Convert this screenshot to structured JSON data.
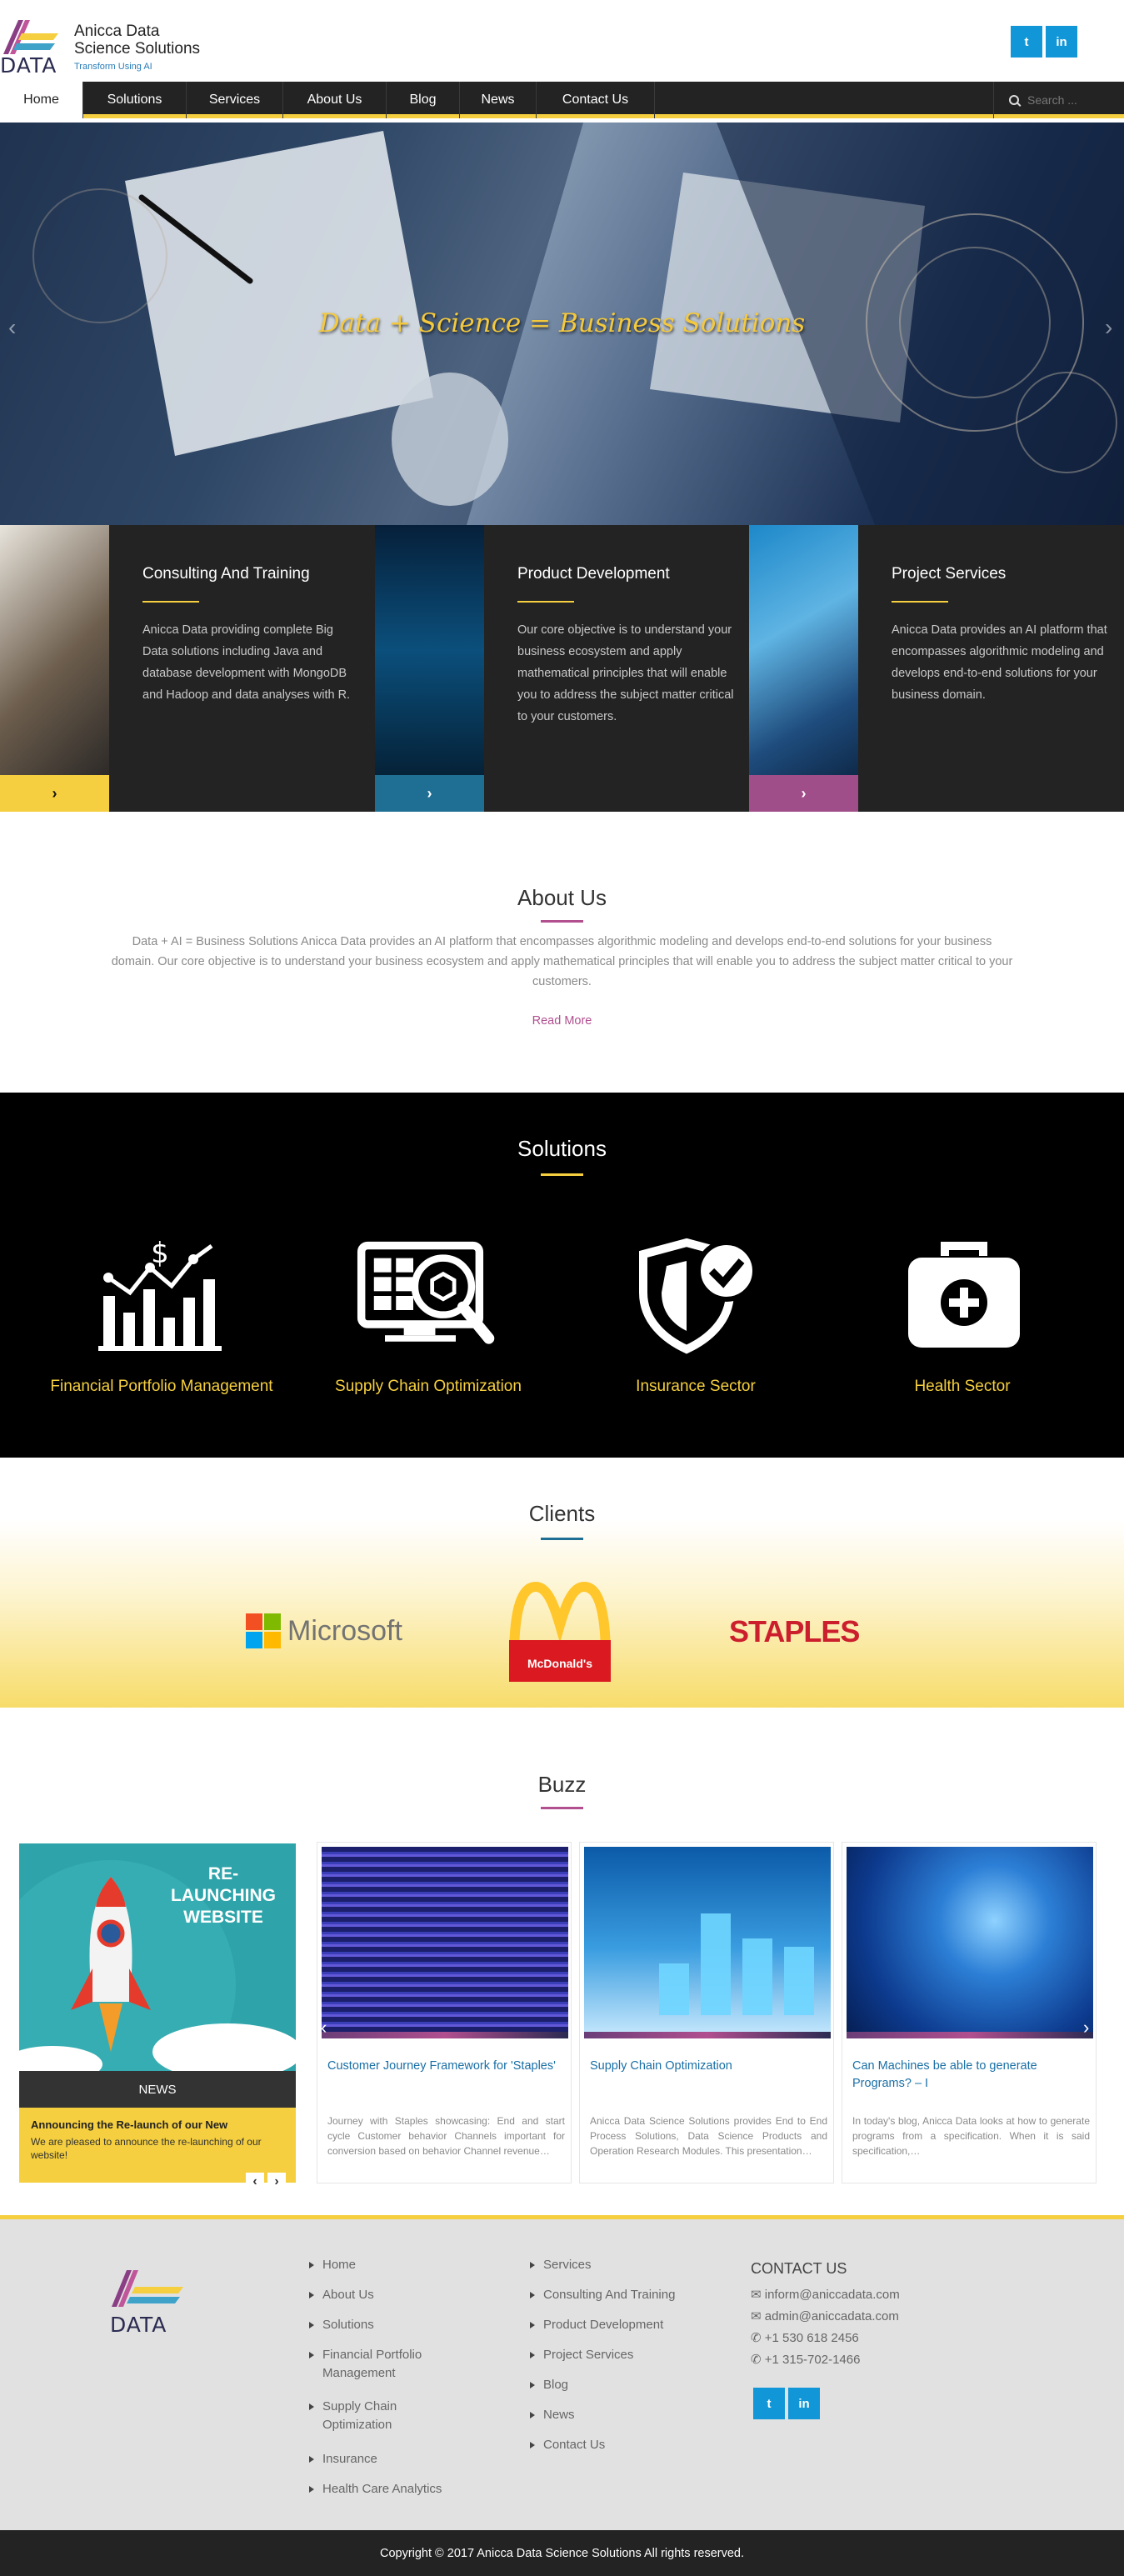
{
  "header": {
    "brand_line1": "Anicca Data",
    "brand_line2": "Science Solutions",
    "tagline": "Transform Using AI",
    "logo_word": "DATA",
    "twitter_glyph": "t",
    "linkedin_glyph": "in"
  },
  "nav": {
    "items": [
      {
        "label": "Home",
        "active": true
      },
      {
        "label": "Solutions"
      },
      {
        "label": "Services"
      },
      {
        "label": "About Us"
      },
      {
        "label": "Blog"
      },
      {
        "label": "News"
      },
      {
        "label": "Contact Us"
      }
    ],
    "search_placeholder": "Search ..."
  },
  "hero": {
    "title": "Data + Science = Business Solutions",
    "prev_glyph": "‹",
    "next_glyph": "›"
  },
  "services": [
    {
      "title": "Consulting And Training",
      "text": "Anicca Data providing complete Big Data solutions including Java and database development with MongoDB and Hadoop and data analyses with R.",
      "button_color": "#f5cf3f",
      "button_glyph": "›"
    },
    {
      "title": "Product Development",
      "text": "Our core objective is to understand your business ecosystem and apply mathematical principles that will enable you to address the subject matter critical to your customers.",
      "button_color": "#1f6f94",
      "button_glyph": "›"
    },
    {
      "title": "Project Services",
      "text": "Anicca Data provides an AI platform that encompasses algorithmic modeling and develops end-to-end solutions for your business domain.",
      "button_color": "#a04e8a",
      "button_glyph": "›"
    }
  ],
  "about": {
    "title": "About Us",
    "text": "Data + AI = Business Solutions Anicca Data provides an AI platform that encompasses algorithmic modeling and develops end-to-end solutions for your business domain. Our core objective is to understand your business ecosystem and apply mathematical principles that will enable you to address the subject matter critical to your customers.",
    "link": "Read More"
  },
  "solutions": {
    "title": "Solutions",
    "items": [
      {
        "label": "Financial Portfolio Management",
        "icon": "financial-chart-icon"
      },
      {
        "label": "Supply Chain Optimization",
        "icon": "supply-chain-icon"
      },
      {
        "label": "Insurance Sector",
        "icon": "shield-check-icon"
      },
      {
        "label": "Health Sector",
        "icon": "medical-kit-icon"
      }
    ]
  },
  "clients": {
    "title": "Clients",
    "logos": [
      {
        "name": "Microsoft"
      },
      {
        "name": "McDonald's"
      },
      {
        "name": "STAPLES"
      }
    ]
  },
  "buzz": {
    "title": "Buzz",
    "news": {
      "image_heading": "RE-LAUNCHING WEBSITE",
      "tag": "NEWS",
      "title": "Announcing the Re-launch of our New",
      "text": "We are pleased to announce the re-launching of our website!",
      "prev_glyph": "‹",
      "next_glyph": "›"
    },
    "posts": [
      {
        "title": "Customer Journey Framework for 'Staples'",
        "text": "Journey with Staples showcasing: End and start cycle Customer behavior Channels important for conversion based on behavior Channel revenue…"
      },
      {
        "title": "Supply Chain Optimization",
        "text": "Anicca Data Science Solutions provides End to End Process Solutions, Data Science Products and Operation Research Modules. This presentation…"
      },
      {
        "title": "Can Machines be able to generate Programs? – I",
        "text": "In today's blog, Anicca Data looks at how to generate programs from a specification. When it is said specification,…"
      }
    ],
    "carousel_prev": "‹",
    "carousel_next": "›"
  },
  "footer": {
    "col1": [
      "Home",
      "About Us",
      "Solutions",
      "Financial Portfolio Management",
      "Supply Chain Optimization",
      "Insurance",
      "Health Care Analytics"
    ],
    "col2": [
      "Services",
      "Consulting And Training",
      "Product Development",
      "Project Services",
      "Blog",
      "News",
      "Contact Us"
    ],
    "contact_title": "CONTACT US",
    "contacts": [
      {
        "icon": "envelope-icon",
        "text": "inform@aniccadata.com"
      },
      {
        "icon": "envelope-icon",
        "text": "admin@aniccadata.com"
      },
      {
        "icon": "phone-icon",
        "text": "+1 530 618 2456"
      },
      {
        "icon": "phone-icon",
        "text": "+1 315-702-1466"
      }
    ],
    "logo_word": "DATA",
    "twitter_glyph": "t",
    "linkedin_glyph": "in"
  },
  "copyright": "Copyright © 2017 Anicca Data Science Solutions   All rights reserved."
}
